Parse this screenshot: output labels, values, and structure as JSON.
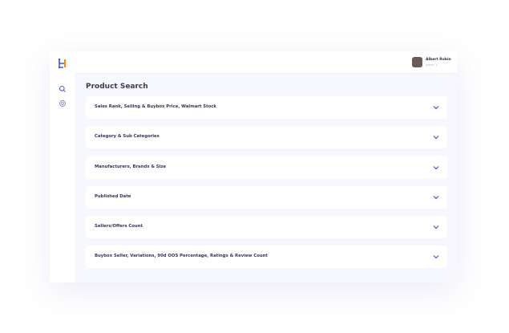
{
  "user": {
    "name": "Albert Robin",
    "role": "Admin ∨"
  },
  "page_title": "Product Search",
  "sections": [
    {
      "label": "Sales Rank, Selling & Buybox Price, Walmart Stock"
    },
    {
      "label": "Category & Sub Categories"
    },
    {
      "label": "Manufacturers, Brands & Size"
    },
    {
      "label": "Published Date"
    },
    {
      "label": "Sellers/Offers Count"
    },
    {
      "label": "Buybox Seller, Variations, 90d OOS Percentage, Ratings & Review Count"
    }
  ],
  "colors": {
    "accent": "#3b5bdb",
    "logo_orange": "#f08a24",
    "background": "#f7f8fd"
  }
}
